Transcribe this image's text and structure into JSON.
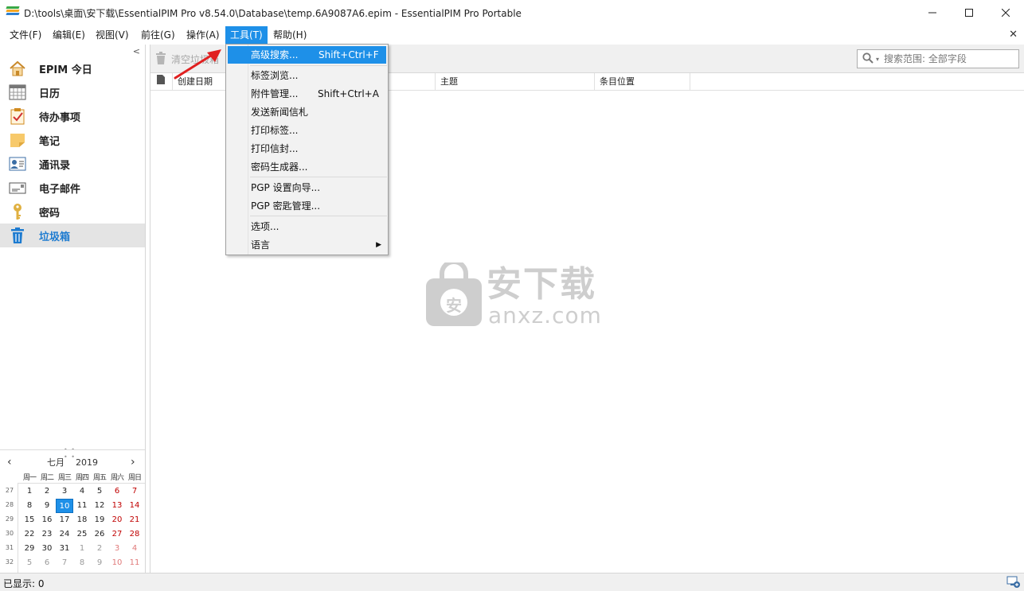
{
  "window": {
    "title": "D:\\tools\\桌面\\安下载\\EssentialPIM Pro v8.54.0\\Database\\temp.6A9087A6.epim - EssentialPIM Pro Portable"
  },
  "menubar": {
    "items": [
      {
        "label": "文件(F)"
      },
      {
        "label": "编辑(E)"
      },
      {
        "label": "视图(V)"
      },
      {
        "label": "前往(G)"
      },
      {
        "label": "操作(A)"
      },
      {
        "label": "工具(T)",
        "active": true
      },
      {
        "label": "帮助(H)"
      }
    ]
  },
  "tools_menu": {
    "items": [
      {
        "label": "高级搜索...",
        "shortcut": "Shift+Ctrl+F",
        "highlighted": true
      },
      {
        "label": "标签浏览..."
      },
      {
        "label": "附件管理...",
        "shortcut": "Shift+Ctrl+A"
      },
      {
        "label": "发送新闻信札"
      },
      {
        "label": "打印标签..."
      },
      {
        "label": "打印信封..."
      },
      {
        "label": "密码生成器..."
      },
      {
        "label": "PGP 设置向导..."
      },
      {
        "label": "PGP 密匙管理..."
      },
      {
        "label": "选项..."
      },
      {
        "label": "语言",
        "submenu": true
      }
    ]
  },
  "sidebar": {
    "items": [
      {
        "label": "EPIM 今日",
        "icon": "home-icon"
      },
      {
        "label": "日历",
        "icon": "calendar-icon"
      },
      {
        "label": "待办事项",
        "icon": "todo-icon"
      },
      {
        "label": "笔记",
        "icon": "note-icon"
      },
      {
        "label": "通讯录",
        "icon": "contacts-icon"
      },
      {
        "label": "电子邮件",
        "icon": "email-icon"
      },
      {
        "label": "密码",
        "icon": "key-icon"
      },
      {
        "label": "垃圾箱",
        "icon": "trash-icon",
        "selected": true
      }
    ]
  },
  "calendar": {
    "month": "七月",
    "year": "2019",
    "weekdays": [
      "周一",
      "周二",
      "周三",
      "周四",
      "周五",
      "周六",
      "周日"
    ],
    "weeks": [
      {
        "wk": "27",
        "days": [
          "1",
          "2",
          "3",
          "4",
          "5",
          "6",
          "7"
        ]
      },
      {
        "wk": "28",
        "days": [
          "8",
          "9",
          "10",
          "11",
          "12",
          "13",
          "14"
        ]
      },
      {
        "wk": "29",
        "days": [
          "15",
          "16",
          "17",
          "18",
          "19",
          "20",
          "21"
        ]
      },
      {
        "wk": "30",
        "days": [
          "22",
          "23",
          "24",
          "25",
          "26",
          "27",
          "28"
        ]
      },
      {
        "wk": "31",
        "days": [
          "29",
          "30",
          "31",
          "1",
          "2",
          "3",
          "4"
        ]
      },
      {
        "wk": "32",
        "days": [
          "5",
          "6",
          "7",
          "8",
          "9",
          "10",
          "11"
        ]
      }
    ],
    "today": "10"
  },
  "toolbar": {
    "empty_trash_label": "清空垃圾箱",
    "search_placeholder": "搜索范围: 全部字段"
  },
  "table": {
    "columns": [
      "创建日期",
      "主题",
      "条目位置"
    ]
  },
  "watermark": {
    "text_cn": "安下载",
    "text_en": "anxz.com",
    "badge": "安"
  },
  "status": {
    "text": "已显示: 0"
  },
  "colors": {
    "accent": "#1e90e8",
    "selected_label": "#1d7bd0",
    "weekend": "#c00000",
    "arrow": "#e02020"
  }
}
